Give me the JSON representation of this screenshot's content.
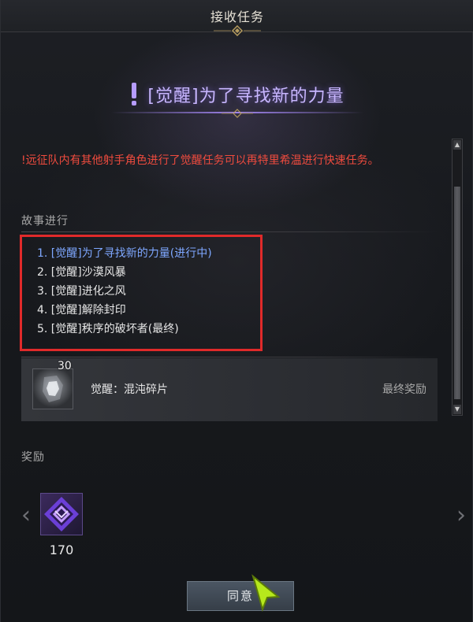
{
  "header": {
    "title": "接收任务"
  },
  "quest": {
    "title": "[觉醒]为了寻找新的力量",
    "warning": "!远征队内有其他射手角色进行了觉醒任务可以再特里希温进行快速任务。"
  },
  "story": {
    "label": "故事进行",
    "items": [
      {
        "text": "1. [觉醒]为了寻找新的力量(进行中)",
        "active": true
      },
      {
        "text": "2. [觉醒]沙漠风暴",
        "active": false
      },
      {
        "text": "3. [觉醒]进化之风",
        "active": false
      },
      {
        "text": "4. [觉醒]解除封印",
        "active": false
      },
      {
        "text": "5. [觉醒]秩序的破坏者(最终)",
        "active": false
      }
    ]
  },
  "final_reward": {
    "count": "30",
    "name": "觉醒：混沌碎片",
    "tag": "最终奖励",
    "icon": "crystal-shard-icon"
  },
  "rewards": {
    "label": "奖励",
    "items": [
      {
        "qty": "170",
        "icon": "purple-diamond-icon"
      }
    ]
  },
  "buttons": {
    "agree": "同意"
  },
  "colors": {
    "warning": "#ef4b3e",
    "active_item": "#7ea7ff",
    "quest_title": "#c8b6ff",
    "highlight_box": "#e02a2a"
  }
}
